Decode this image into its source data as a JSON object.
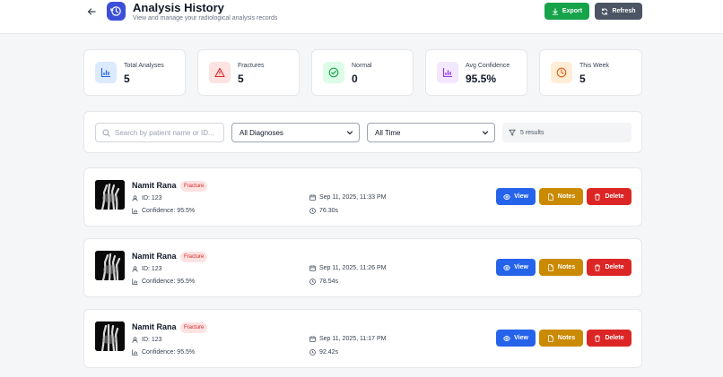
{
  "header": {
    "title": "Analysis History",
    "subtitle": "View and manage your radiological analysis records",
    "export_label": "Export",
    "refresh_label": "Refresh"
  },
  "stats": [
    {
      "label": "Total Analyses",
      "value": "5",
      "icon": "bar-chart-icon",
      "color": "#2563eb",
      "bg": "#dbeafe"
    },
    {
      "label": "Fractures",
      "value": "5",
      "icon": "warning-icon",
      "color": "#dc2626",
      "bg": "#fde2e2"
    },
    {
      "label": "Normal",
      "value": "0",
      "icon": "check-circle-icon",
      "color": "#16a34a",
      "bg": "#dcfce7"
    },
    {
      "label": "Avg Confidence",
      "value": "95.5%",
      "icon": "bar-chart-icon",
      "color": "#9333ea",
      "bg": "#f3e8ff"
    },
    {
      "label": "This Week",
      "value": "5",
      "icon": "clock-icon",
      "color": "#ea580c",
      "bg": "#ffedd5"
    }
  ],
  "filters": {
    "search_placeholder": "Search by patient name or ID...",
    "diagnosis_value": "All Diagnoses",
    "time_value": "All Time",
    "results_text": "5 results"
  },
  "records": [
    {
      "name": "Namit Rana",
      "badge": "Fracture",
      "id_text": "ID: 123",
      "confidence_text": "Confidence: 95.5%",
      "date": "Sep 11, 2025, 11:33 PM",
      "duration": "76.30s"
    },
    {
      "name": "Namit Rana",
      "badge": "Fracture",
      "id_text": "ID: 123",
      "confidence_text": "Confidence: 95.5%",
      "date": "Sep 11, 2025, 11:26 PM",
      "duration": "78.54s"
    },
    {
      "name": "Namit Rana",
      "badge": "Fracture",
      "id_text": "ID: 123",
      "confidence_text": "Confidence: 95.5%",
      "date": "Sep 11, 2025, 11:17 PM",
      "duration": "92.42s"
    }
  ],
  "actions": {
    "view_label": "View",
    "notes_label": "Notes",
    "delete_label": "Delete"
  }
}
